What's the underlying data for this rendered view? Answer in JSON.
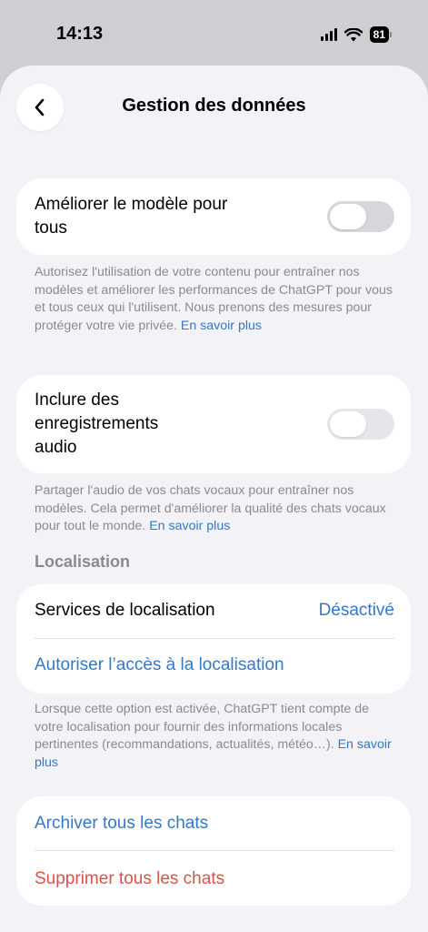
{
  "status_bar": {
    "time": "14:13",
    "battery": "81"
  },
  "header": {
    "title": "Gestion des données"
  },
  "improve_model": {
    "label": "Améliorer le modèle pour tous",
    "enabled": false,
    "description": "Autorisez l'utilisation de votre contenu pour entraîner nos modèles et améliorer les performances de ChatGPT pour vous et tous ceux qui l'utilisent. Nous prenons des mesures pour protéger votre vie privée.",
    "link": "En savoir plus"
  },
  "audio_recordings": {
    "label": "Inclure des enregistrements audio",
    "enabled": false,
    "description": "Partager l'audio de vos chats vocaux pour entraîner nos modèles. Cela permet d'améliorer la qualité des chats vocaux pour tout le monde.",
    "link": "En savoir plus"
  },
  "location": {
    "section_title": "Localisation",
    "services_label": "Services de localisation",
    "services_value": "Désactivé",
    "allow_access": "Autoriser l’accès à la localisation",
    "description": "Lorsque cette option est activée, ChatGPT tient compte de votre localisation pour fournir des informations locales pertinentes (recommandations, actualités, météo…).",
    "link": "En savoir plus"
  },
  "chats": {
    "archive_all": "Archiver tous les chats",
    "delete_all": "Supprimer tous les chats"
  },
  "colors": {
    "link": "#3478c6",
    "destructive": "#d9534a",
    "toggle_off": "#d7d7db"
  }
}
